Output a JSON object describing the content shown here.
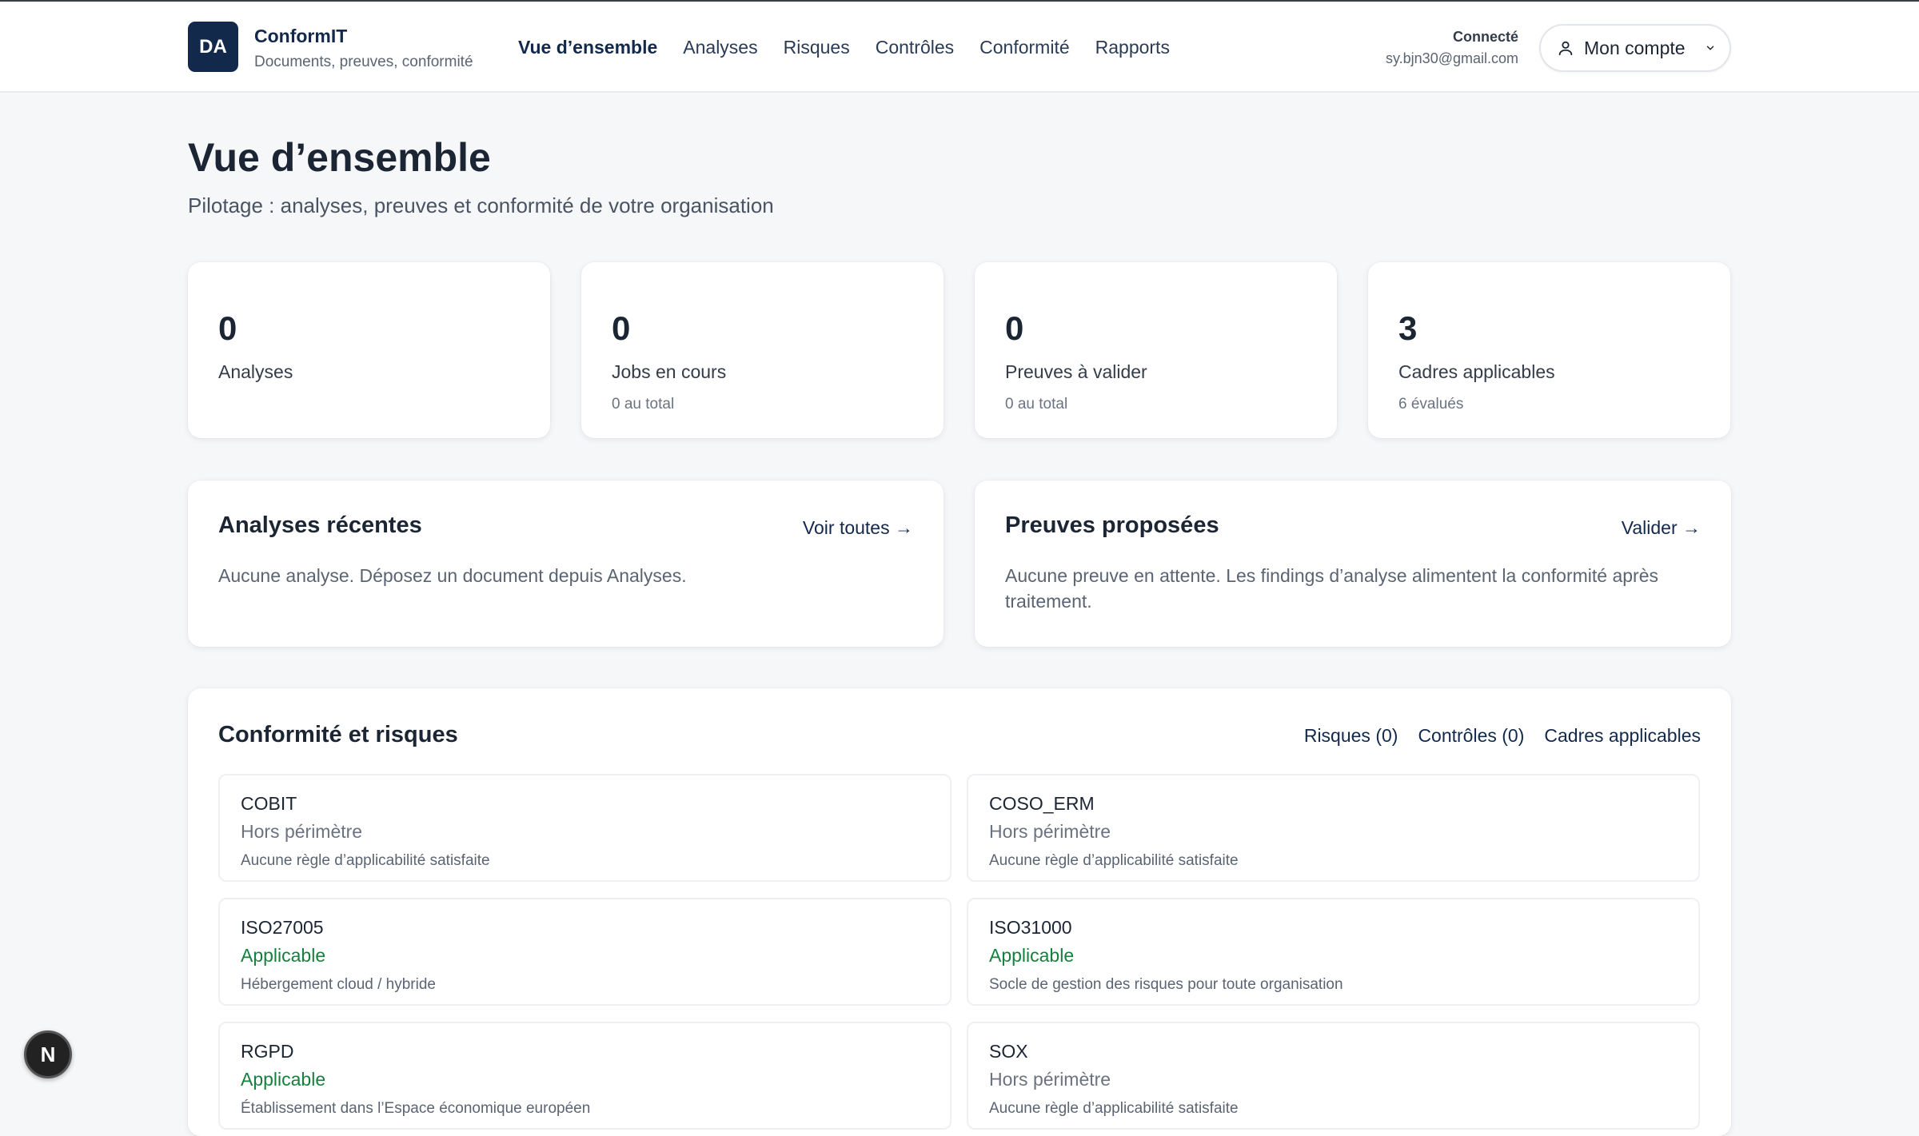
{
  "header": {
    "logo_initials": "DA",
    "brand_name": "ConformIT",
    "brand_tagline": "Documents, preuves, conformité",
    "nav": [
      "Vue d’ensemble",
      "Analyses",
      "Risques",
      "Contrôles",
      "Conformité",
      "Rapports"
    ],
    "active_nav": "Vue d’ensemble",
    "user_label": "Connecté",
    "user_email": "sy.bjn30@gmail.com",
    "account_label": "Mon compte"
  },
  "page": {
    "title": "Vue d’ensemble",
    "subtitle": "Pilotage : analyses, preuves et conformité de votre organisation"
  },
  "stats": [
    {
      "value": "0",
      "label": "Analyses",
      "sub": ""
    },
    {
      "value": "0",
      "label": "Jobs en cours",
      "sub": "0 au total"
    },
    {
      "value": "0",
      "label": "Preuves à valider",
      "sub": "0 au total"
    },
    {
      "value": "3",
      "label": "Cadres applicables",
      "sub": "6 évalués"
    }
  ],
  "recent_analyses": {
    "title": "Analyses récentes",
    "link": "Voir toutes →",
    "empty_text": "Aucune analyse. Déposez un document depuis Analyses."
  },
  "proposed_proofs": {
    "title": "Preuves proposées",
    "link": "Valider →",
    "empty_text": "Aucune preuve en attente. Les findings d’analyse alimentent la conformité après traitement."
  },
  "compliance": {
    "title": "Conformité et risques",
    "links": [
      "Risques (0)",
      "Contrôles (0)",
      "Cadres applicables"
    ],
    "frameworks": [
      {
        "name": "COBIT",
        "status": "Hors périmètre",
        "note": "Aucune règle d’applicabilité satisfaite"
      },
      {
        "name": "COSO_ERM",
        "status": "Hors périmètre",
        "note": "Aucune règle d’applicabilité satisfaite"
      },
      {
        "name": "ISO27005",
        "status": "Applicable",
        "note": "Hébergement cloud / hybride"
      },
      {
        "name": "ISO31000",
        "status": "Applicable",
        "note": "Socle de gestion des risques pour toute organisation"
      },
      {
        "name": "RGPD",
        "status": "Applicable",
        "note": "Établissement dans l’Espace économique européen"
      },
      {
        "name": "SOX",
        "status": "Hors périmètre",
        "note": "Aucune règle d’applicabilité satisfaite"
      }
    ]
  },
  "colors": {
    "brand": "#13294b",
    "applicable": "#15803d",
    "out_of_scope": "#6b7380"
  },
  "fab_label": "N"
}
